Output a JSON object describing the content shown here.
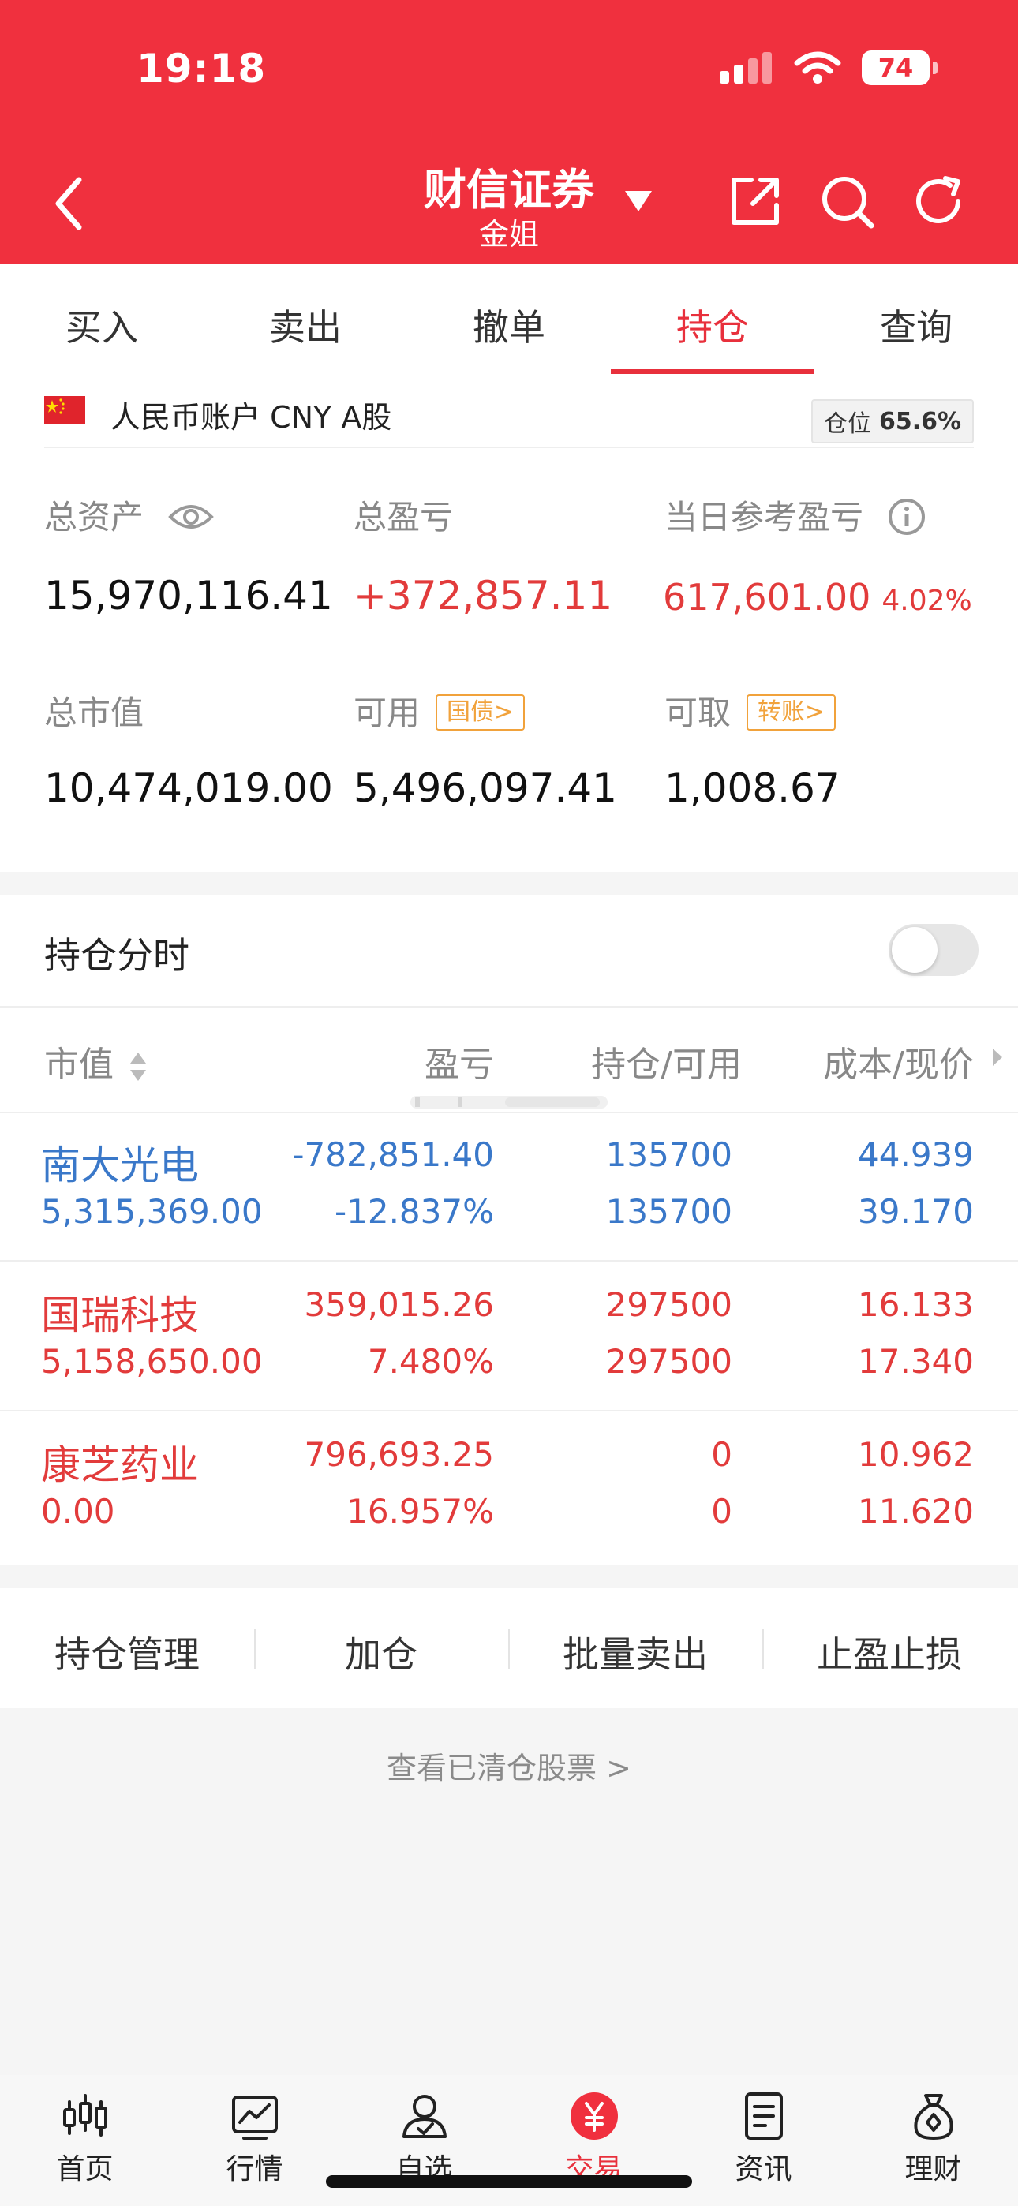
{
  "status_bar": {
    "time": "19:18",
    "battery": "74"
  },
  "header": {
    "title": "财信证券",
    "subtitle": "金姐"
  },
  "tabs": [
    {
      "label": "买入"
    },
    {
      "label": "卖出"
    },
    {
      "label": "撤单"
    },
    {
      "label": "持仓",
      "active": true
    },
    {
      "label": "查询"
    }
  ],
  "account": {
    "label": "人民币账户 CNY A股",
    "position_label": "仓位",
    "position_value": "65.6%",
    "total_assets_label": "总资产",
    "total_assets": "15,970,116.41",
    "total_pnl_label": "总盈亏",
    "total_pnl": "+372,857.11",
    "daily_pnl_label": "当日参考盈亏",
    "daily_pnl": "617,601.00",
    "daily_pnl_pct": "4.02%",
    "market_value_label": "总市值",
    "market_value": "10,474,019.00",
    "available_label": "可用",
    "available_tag": "国债>",
    "available": "5,496,097.41",
    "withdrawable_label": "可取",
    "withdrawable_tag": "转账>",
    "withdrawable": "1,008.67"
  },
  "holdings": {
    "title": "持仓分时",
    "columns": {
      "market_value": "市值",
      "pnl": "盈亏",
      "shares": "持仓/可用",
      "cost_price": "成本/现价"
    },
    "rows": [
      {
        "name": "南大光电",
        "market_value": "5,315,369.00",
        "pnl": "-782,851.40",
        "pnl_pct": "-12.837%",
        "position": "135700",
        "available": "135700",
        "cost": "44.939",
        "price": "39.170",
        "trend": "down"
      },
      {
        "name": "国瑞科技",
        "market_value": "5,158,650.00",
        "pnl": "359,015.26",
        "pnl_pct": "7.480%",
        "position": "297500",
        "available": "297500",
        "cost": "16.133",
        "price": "17.340",
        "trend": "up"
      },
      {
        "name": "康芝药业",
        "market_value": "0.00",
        "pnl": "796,693.25",
        "pnl_pct": "16.957%",
        "position": "0",
        "available": "0",
        "cost": "10.962",
        "price": "11.620",
        "trend": "up"
      }
    ]
  },
  "actions": [
    {
      "label": "持仓管理"
    },
    {
      "label": "加仓"
    },
    {
      "label": "批量卖出"
    },
    {
      "label": "止盈止损"
    }
  ],
  "cleared_link": "查看已清仓股票 >",
  "bottom_nav": [
    {
      "label": "首页"
    },
    {
      "label": "行情"
    },
    {
      "label": "自选"
    },
    {
      "label": "交易",
      "active": true
    },
    {
      "label": "资讯"
    },
    {
      "label": "理财"
    }
  ],
  "colors": {
    "brand_red": "#f0303e",
    "gain_red": "#e23b3b",
    "loss_blue": "#3a78c9",
    "tag_orange": "#f1a23b"
  },
  "icons": {
    "header": [
      "back-icon",
      "caret-down-icon",
      "share-icon",
      "search-icon",
      "refresh-icon"
    ],
    "account": [
      "china-flag-icon",
      "eye-icon",
      "info-icon",
      "sort-icon",
      "chevron-right-icon"
    ],
    "bottom_nav": [
      "candlestick-icon",
      "line-chart-icon",
      "user-check-icon",
      "yuan-icon",
      "news-icon",
      "money-bag-icon"
    ]
  }
}
